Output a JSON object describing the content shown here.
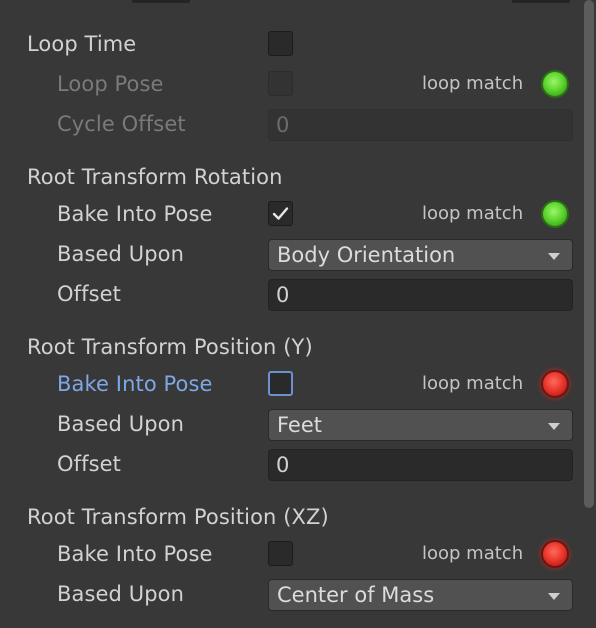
{
  "loop_time": {
    "label": "Loop Time",
    "loop_pose_label": "Loop Pose",
    "cycle_offset_label": "Cycle Offset",
    "cycle_offset_value": "0",
    "loop_match_label": "loop match",
    "loop_match_status": "green"
  },
  "root_rotation": {
    "title": "Root Transform Rotation",
    "bake_label": "Bake Into Pose",
    "bake_checked": true,
    "loop_match_label": "loop match",
    "loop_match_status": "green",
    "based_upon_label": "Based Upon",
    "based_upon_value": "Body Orientation",
    "offset_label": "Offset",
    "offset_value": "0"
  },
  "root_position_y": {
    "title": "Root Transform Position (Y)",
    "bake_label": "Bake Into Pose",
    "bake_checked": false,
    "loop_match_label": "loop match",
    "loop_match_status": "red",
    "based_upon_label": "Based Upon",
    "based_upon_value": "Feet",
    "offset_label": "Offset",
    "offset_value": "0"
  },
  "root_position_xz": {
    "title": "Root Transform Position (XZ)",
    "bake_label": "Bake Into Pose",
    "bake_checked": false,
    "loop_match_label": "loop match",
    "loop_match_status": "red",
    "based_upon_label": "Based Upon",
    "based_upon_value": "Center of Mass"
  },
  "colors": {
    "background": "#383838",
    "label_text": "#d2d2d2",
    "disabled_text": "#7a7a7a",
    "focus_label": "#7ea7e6",
    "match_good": "#5fd630",
    "match_bad": "#e7342b"
  }
}
